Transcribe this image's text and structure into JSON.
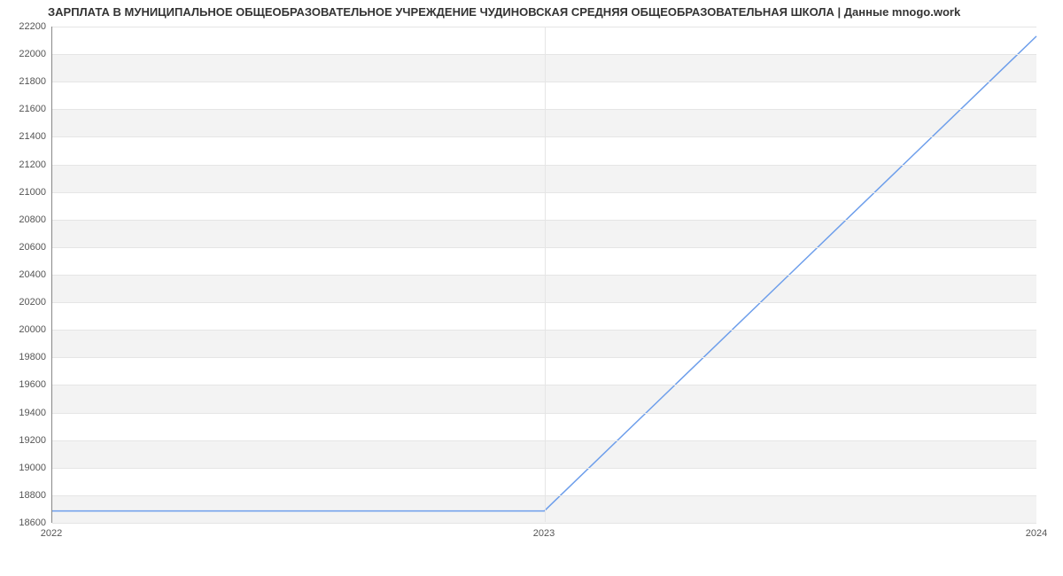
{
  "chart_data": {
    "type": "line",
    "title": "ЗАРПЛАТА В МУНИЦИПАЛЬНОЕ ОБЩЕОБРАЗОВАТЕЛЬНОЕ УЧРЕЖДЕНИЕ ЧУДИНОВСКАЯ СРЕДНЯЯ ОБЩЕОБРАЗОВАТЕЛЬНАЯ ШКОЛА | Данные mnogo.work",
    "xlabel": "",
    "ylabel": "",
    "x_ticks": [
      "2022",
      "2023",
      "2024"
    ],
    "y_ticks": [
      18600,
      18800,
      19000,
      19200,
      19400,
      19600,
      19800,
      20000,
      20200,
      20400,
      20600,
      20800,
      21000,
      21200,
      21400,
      21600,
      21800,
      22000,
      22200
    ],
    "ylim": [
      18600,
      22200
    ],
    "x": [
      "2022",
      "2023",
      "2024"
    ],
    "values": [
      18680,
      18680,
      22130
    ],
    "line_color": "#6d9eeb",
    "grid": true
  }
}
